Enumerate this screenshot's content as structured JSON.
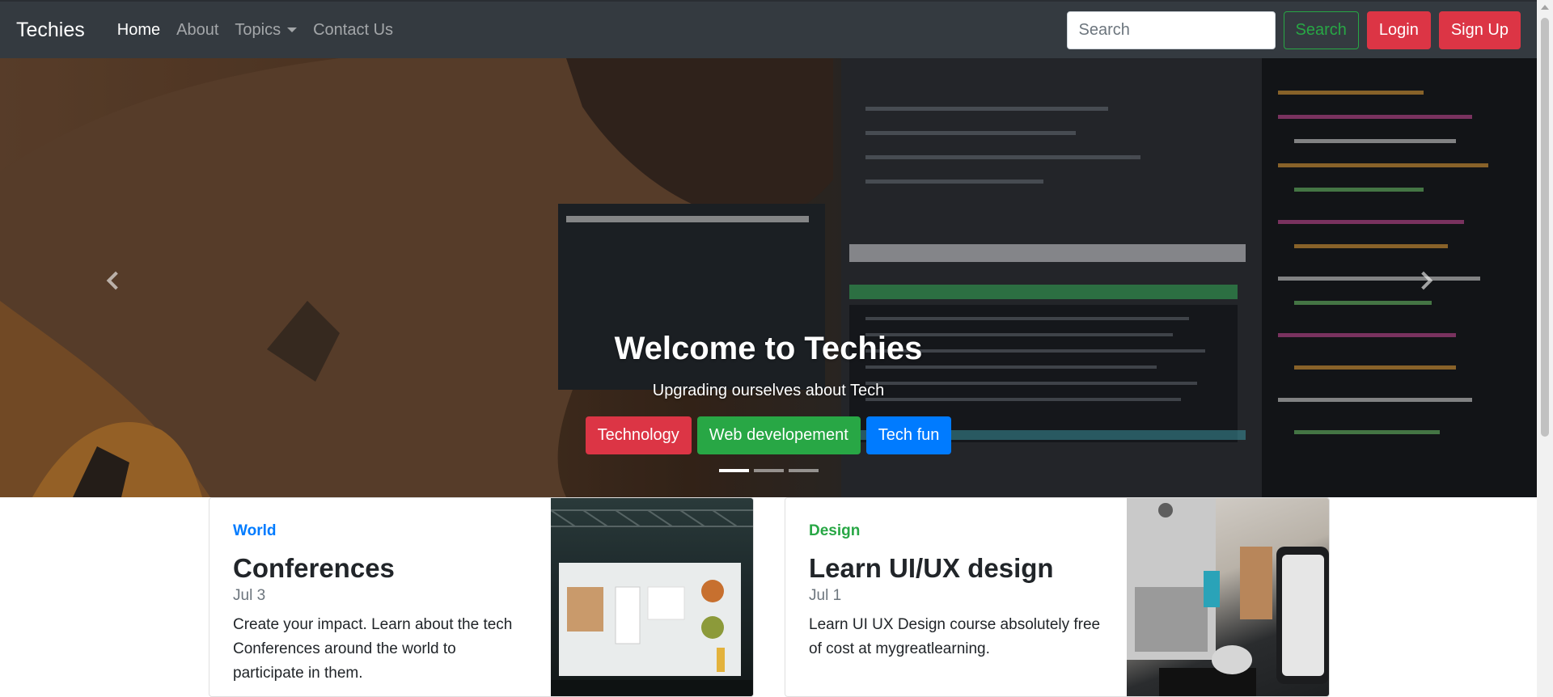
{
  "navbar": {
    "brand": "Techies",
    "links": [
      {
        "label": "Home",
        "active": true
      },
      {
        "label": "About",
        "active": false
      },
      {
        "label": "Topics",
        "active": false,
        "dropdown": true
      },
      {
        "label": "Contact Us",
        "active": false
      }
    ],
    "search_placeholder": "Search",
    "search_button": "Search",
    "login_button": "Login",
    "signup_button": "Sign Up"
  },
  "carousel": {
    "title": "Welcome to Techies",
    "subtitle": "Upgrading ourselves about Tech",
    "buttons": [
      "Technology",
      "Web developement",
      "Tech fun"
    ],
    "slide_count": 3,
    "active_slide": 0
  },
  "cards": [
    {
      "category": "World",
      "title": "Conferences",
      "date": "Jul 3",
      "text": "Create your impact. Learn about the tech Conferences around the world to participate in them."
    },
    {
      "category": "Design",
      "title": "Learn UI/UX design",
      "date": "Jul 1",
      "text": "Learn UI UX Design course absolutely free of cost at mygreatlearning."
    }
  ],
  "colors": {
    "navbar_bg": "#343a40",
    "danger": "#dc3545",
    "success": "#28a745",
    "primary": "#007bff"
  }
}
